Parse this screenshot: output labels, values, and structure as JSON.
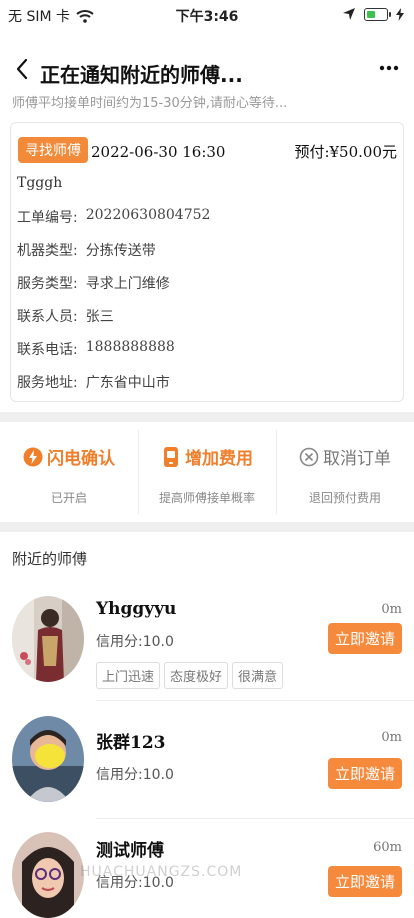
{
  "status_bar": {
    "carrier": "无 SIM 卡",
    "time": "下午3:46",
    "battery_level": 0.5
  },
  "header": {
    "title": "正在通知附近的师傅...",
    "subtitle": "师傅平均接单时间约为15-30分钟,请耐心等待..."
  },
  "order": {
    "tag": "寻找师傅",
    "time": "2022-06-30 16:30",
    "prepay": "预付:¥50.00元",
    "name": "Tgggh",
    "fields": [
      {
        "label": "工单编号:",
        "value": "20220630804752"
      },
      {
        "label": "机器类型:",
        "value": "分拣传送带"
      },
      {
        "label": "服务类型:",
        "value": "寻求上门维修"
      },
      {
        "label": "联系人员:",
        "value": "张三"
      },
      {
        "label": "联系电话:",
        "value": "1888888888"
      },
      {
        "label": "服务地址:",
        "value": "广东省中山市"
      }
    ]
  },
  "actions": [
    {
      "label": "闪电确认",
      "sub": "已开启",
      "icon": "lightning-icon"
    },
    {
      "label": "增加费用",
      "sub": "提高师傅接单概率",
      "icon": "phone-fee-icon"
    },
    {
      "label": "取消订单",
      "sub": "退回预付费用",
      "icon": "cancel-icon"
    }
  ],
  "nearby": {
    "title": "附近的师傅",
    "technicians": [
      {
        "name": "Yhggyyu",
        "distance": "0m",
        "credit": "信用分:10.0",
        "invite": "立即邀请",
        "tags": [
          "上门迅速",
          "态度极好",
          "很满意"
        ]
      },
      {
        "name": "张群123",
        "distance": "0m",
        "credit": "信用分:10.0",
        "invite": "立即邀请",
        "tags": []
      },
      {
        "name": "测试师傅",
        "distance": "60m",
        "credit": "信用分:10.0",
        "invite": "立即邀请",
        "tags": []
      }
    ]
  },
  "watermark": "HUACHUANGZS.COM",
  "colors": {
    "accent": "#f28a3a",
    "battery": "#3cc14e"
  }
}
